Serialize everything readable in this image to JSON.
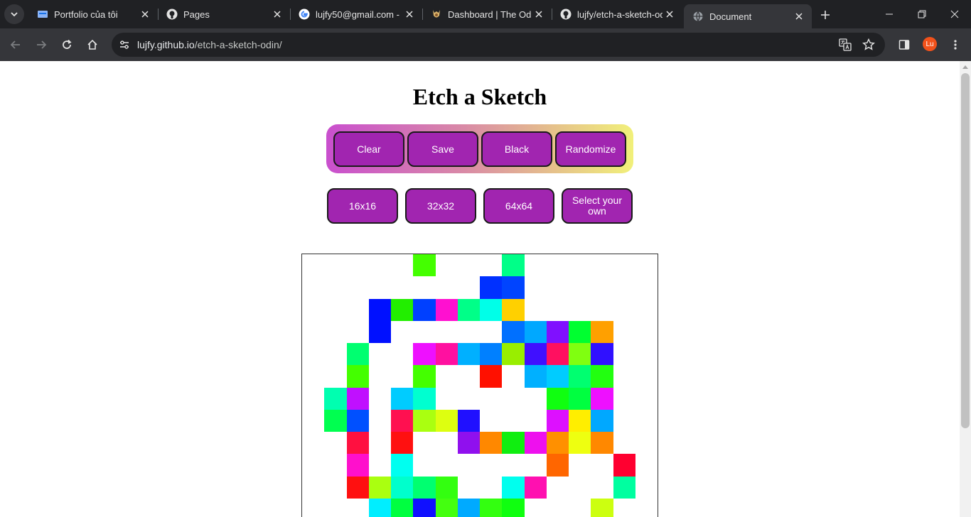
{
  "browser": {
    "tabs": [
      {
        "title": "Portfolio của tôi",
        "icon": "portfolio-favicon",
        "active": false
      },
      {
        "title": "Pages",
        "icon": "github-icon",
        "active": false
      },
      {
        "title": "lujfy50@gmail.com - ",
        "icon": "google-icon",
        "active": false
      },
      {
        "title": "Dashboard | The Odin",
        "icon": "odin-icon",
        "active": false
      },
      {
        "title": "lujfy/etch-a-sketch-od",
        "icon": "github-icon",
        "active": false
      },
      {
        "title": "Document",
        "icon": "globe-icon",
        "active": true
      }
    ],
    "url_host": "lujfy.github.io",
    "url_path": "/etch-a-sketch-odin/",
    "profile_initials": "Lu"
  },
  "page": {
    "title": "Etch a Sketch",
    "controls": [
      "Clear",
      "Save",
      "Black",
      "Randomize"
    ],
    "sizes": [
      "16x16",
      "32x32",
      "64x64",
      "Select your own"
    ]
  },
  "colors": {
    "button_bg": "#a125b0",
    "gradient_start": "#c94fce",
    "gradient_end": "#f1f07a"
  },
  "sketch": {
    "grid_size": 16,
    "cells": [
      {
        "r": 0,
        "c": 5,
        "color": "#44ff00"
      },
      {
        "r": 0,
        "c": 9,
        "color": "#00ff88"
      },
      {
        "r": 1,
        "c": 8,
        "color": "#0030ff"
      },
      {
        "r": 1,
        "c": 9,
        "color": "#0044ff"
      },
      {
        "r": 2,
        "c": 3,
        "color": "#0010ff"
      },
      {
        "r": 2,
        "c": 4,
        "color": "#22ee00"
      },
      {
        "r": 2,
        "c": 5,
        "color": "#0040ff"
      },
      {
        "r": 2,
        "c": 6,
        "color": "#ff10d0"
      },
      {
        "r": 2,
        "c": 7,
        "color": "#00ff88"
      },
      {
        "r": 2,
        "c": 8,
        "color": "#00ffe8"
      },
      {
        "r": 2,
        "c": 9,
        "color": "#ffd000"
      },
      {
        "r": 3,
        "c": 3,
        "color": "#0010ff"
      },
      {
        "r": 3,
        "c": 9,
        "color": "#0070ff"
      },
      {
        "r": 3,
        "c": 10,
        "color": "#00a8ff"
      },
      {
        "r": 3,
        "c": 11,
        "color": "#8010ff"
      },
      {
        "r": 3,
        "c": 12,
        "color": "#00ff30"
      },
      {
        "r": 3,
        "c": 13,
        "color": "#ffa000"
      },
      {
        "r": 4,
        "c": 2,
        "color": "#00ff70"
      },
      {
        "r": 4,
        "c": 5,
        "color": "#ee10ff"
      },
      {
        "r": 4,
        "c": 6,
        "color": "#ff10a0"
      },
      {
        "r": 4,
        "c": 7,
        "color": "#00b0ff"
      },
      {
        "r": 4,
        "c": 8,
        "color": "#0080ff"
      },
      {
        "r": 4,
        "c": 9,
        "color": "#99ee00"
      },
      {
        "r": 4,
        "c": 10,
        "color": "#4010ff"
      },
      {
        "r": 4,
        "c": 11,
        "color": "#ff1060"
      },
      {
        "r": 4,
        "c": 12,
        "color": "#80ff10"
      },
      {
        "r": 4,
        "c": 13,
        "color": "#3010ff"
      },
      {
        "r": 5,
        "c": 2,
        "color": "#44ff00"
      },
      {
        "r": 5,
        "c": 5,
        "color": "#44ff00"
      },
      {
        "r": 5,
        "c": 8,
        "color": "#ff1000"
      },
      {
        "r": 5,
        "c": 10,
        "color": "#00b0ff"
      },
      {
        "r": 5,
        "c": 11,
        "color": "#00ccff"
      },
      {
        "r": 5,
        "c": 12,
        "color": "#00ff70"
      },
      {
        "r": 5,
        "c": 13,
        "color": "#22ff10"
      },
      {
        "r": 6,
        "c": 1,
        "color": "#00ffb0"
      },
      {
        "r": 6,
        "c": 2,
        "color": "#c010ff"
      },
      {
        "r": 6,
        "c": 4,
        "color": "#00ccff"
      },
      {
        "r": 6,
        "c": 5,
        "color": "#00ffd0"
      },
      {
        "r": 6,
        "c": 11,
        "color": "#10ff10"
      },
      {
        "r": 6,
        "c": 12,
        "color": "#00ff40"
      },
      {
        "r": 6,
        "c": 13,
        "color": "#ee10ff"
      },
      {
        "r": 7,
        "c": 1,
        "color": "#00ff50"
      },
      {
        "r": 7,
        "c": 2,
        "color": "#0050ff"
      },
      {
        "r": 7,
        "c": 4,
        "color": "#ff1050"
      },
      {
        "r": 7,
        "c": 5,
        "color": "#aaff10"
      },
      {
        "r": 7,
        "c": 6,
        "color": "#ddff10"
      },
      {
        "r": 7,
        "c": 7,
        "color": "#2010ff"
      },
      {
        "r": 7,
        "c": 11,
        "color": "#dd10ff"
      },
      {
        "r": 7,
        "c": 12,
        "color": "#ffee00"
      },
      {
        "r": 7,
        "c": 13,
        "color": "#00a8ff"
      },
      {
        "r": 8,
        "c": 2,
        "color": "#ff1040"
      },
      {
        "r": 8,
        "c": 4,
        "color": "#ff1010"
      },
      {
        "r": 8,
        "c": 7,
        "color": "#9010ee"
      },
      {
        "r": 8,
        "c": 8,
        "color": "#ff8800"
      },
      {
        "r": 8,
        "c": 9,
        "color": "#10ee10"
      },
      {
        "r": 8,
        "c": 10,
        "color": "#ee10ee"
      },
      {
        "r": 8,
        "c": 11,
        "color": "#ff9000"
      },
      {
        "r": 8,
        "c": 12,
        "color": "#eeff10"
      },
      {
        "r": 8,
        "c": 13,
        "color": "#ff8800"
      },
      {
        "r": 9,
        "c": 2,
        "color": "#ff10cc"
      },
      {
        "r": 9,
        "c": 4,
        "color": "#00fff0"
      },
      {
        "r": 9,
        "c": 11,
        "color": "#ff6600"
      },
      {
        "r": 9,
        "c": 14,
        "color": "#ff0030"
      },
      {
        "r": 10,
        "c": 2,
        "color": "#ff1010"
      },
      {
        "r": 10,
        "c": 3,
        "color": "#aaff10"
      },
      {
        "r": 10,
        "c": 4,
        "color": "#00ffcc"
      },
      {
        "r": 10,
        "c": 5,
        "color": "#00ff70"
      },
      {
        "r": 10,
        "c": 6,
        "color": "#33ff10"
      },
      {
        "r": 10,
        "c": 9,
        "color": "#00ffee"
      },
      {
        "r": 10,
        "c": 10,
        "color": "#ff10b0"
      },
      {
        "r": 10,
        "c": 14,
        "color": "#00ffa0"
      },
      {
        "r": 11,
        "c": 3,
        "color": "#00eeff"
      },
      {
        "r": 11,
        "c": 4,
        "color": "#00ff40"
      },
      {
        "r": 11,
        "c": 5,
        "color": "#1010ff"
      },
      {
        "r": 11,
        "c": 6,
        "color": "#44ff10"
      },
      {
        "r": 11,
        "c": 7,
        "color": "#00aaff"
      },
      {
        "r": 11,
        "c": 8,
        "color": "#33ff10"
      },
      {
        "r": 11,
        "c": 9,
        "color": "#10ff10"
      },
      {
        "r": 11,
        "c": 13,
        "color": "#ccff10"
      }
    ]
  }
}
